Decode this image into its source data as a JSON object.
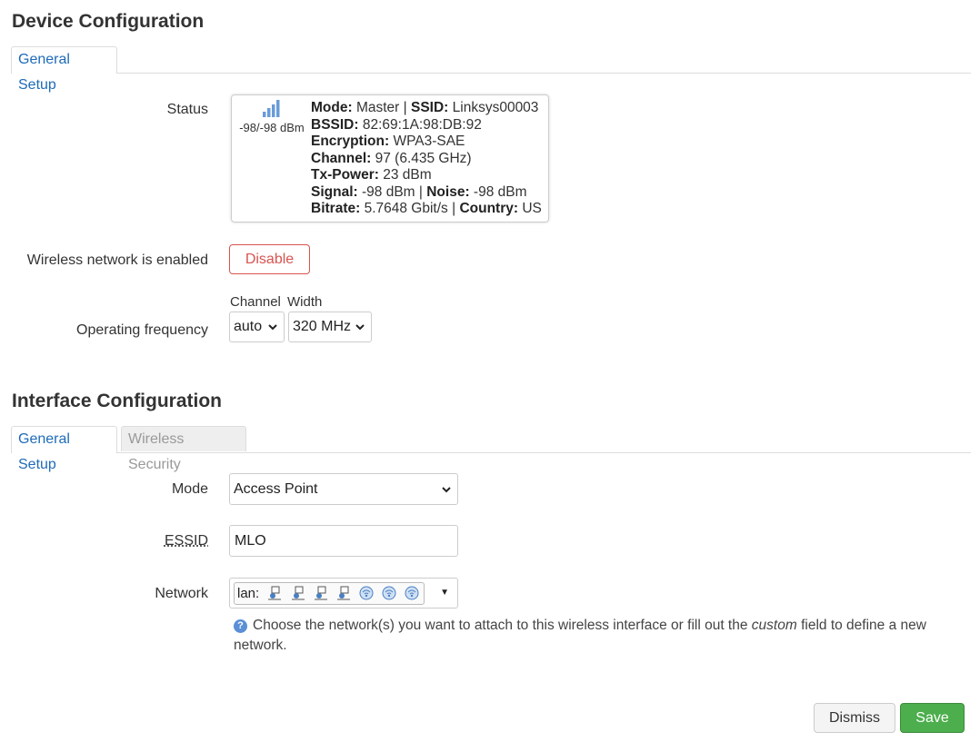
{
  "device_config": {
    "title": "Device Configuration",
    "tabs": [
      {
        "label": "General Setup",
        "active": true
      }
    ],
    "status": {
      "label": "Status",
      "signal_text": "-98/-98 dBm",
      "mode_label": "Mode:",
      "mode_value": "Master",
      "ssid_label": "SSID:",
      "ssid_value": "Linksys00003",
      "bssid_label": "BSSID:",
      "bssid_value": "82:69:1A:98:DB:92",
      "encryption_label": "Encryption:",
      "encryption_value": "WPA3-SAE",
      "channel_label": "Channel:",
      "channel_value": "97 (6.435 GHz)",
      "txpower_label": "Tx-Power:",
      "txpower_value": "23 dBm",
      "signal_label": "Signal:",
      "signal_value": "-98 dBm",
      "noise_label": "Noise:",
      "noise_value": "-98 dBm",
      "bitrate_label": "Bitrate:",
      "bitrate_value": "5.7648 Gbit/s",
      "country_label": "Country:",
      "country_value": "US",
      "separator": "|"
    },
    "wireless_enabled_label": "Wireless network is enabled",
    "disable_button": "Disable",
    "operating_frequency": {
      "label": "Operating frequency",
      "channel_header": "Channel",
      "width_header": "Width",
      "channel_value": "auto",
      "width_value": "320 MHz"
    }
  },
  "interface_config": {
    "title": "Interface Configuration",
    "tabs": [
      {
        "label": "General Setup",
        "active": true
      },
      {
        "label": "Wireless Security",
        "active": false
      }
    ],
    "mode_label": "Mode",
    "mode_value": "Access Point",
    "essid_label": "ESSID",
    "essid_value": "MLO",
    "network_label": "Network",
    "network_value": "lan:",
    "help_text_1": "Choose the network(s) you want to attach to this wireless interface or fill out the ",
    "help_text_em": "custom",
    "help_text_2": " field to define a new network."
  },
  "footer": {
    "dismiss": "Dismiss",
    "save": "Save"
  },
  "colors": {
    "accent_blue": "#1e6bb8",
    "danger_red": "#d9534f",
    "save_green": "#4cae4c"
  }
}
